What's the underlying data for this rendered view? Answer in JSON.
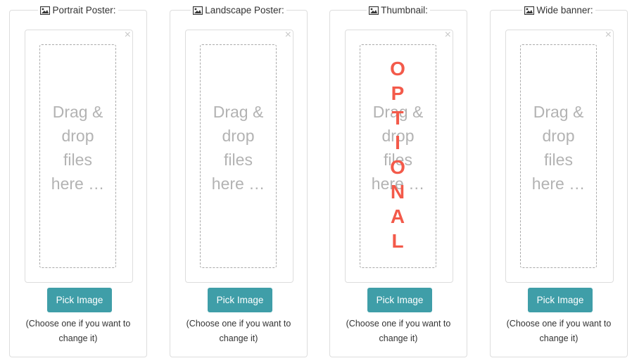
{
  "panels": [
    {
      "title": "Portrait Poster:",
      "drop_text": "Drag & drop files here …",
      "button": "Pick Image",
      "hint": "(Choose one if you want to change it)",
      "close": "×"
    },
    {
      "title": "Landscape Poster:",
      "drop_text": "Drag & drop files here …",
      "button": "Pick Image",
      "hint": "(Choose one if you want to change it)",
      "close": "×"
    },
    {
      "title": "Thumbnail:",
      "drop_text": "Drag & drop files here …",
      "button": "Pick Image",
      "hint": "(Choose one if you want to change it)",
      "close": "×"
    },
    {
      "title": "Wide banner:",
      "drop_text": "Drag & drop files here …",
      "button": "Pick Image",
      "hint": "(Choose one if you want to change it)",
      "close": "×"
    }
  ],
  "overlay": {
    "letters": [
      "O",
      "P",
      "T",
      "I",
      "O",
      "N",
      "A",
      "L"
    ],
    "color": "#f35a4a"
  },
  "colors": {
    "button": "#3f9ea8",
    "drop_text": "#b3b3b3"
  },
  "icons": {
    "legend": "image-icon",
    "close": "close-icon"
  }
}
